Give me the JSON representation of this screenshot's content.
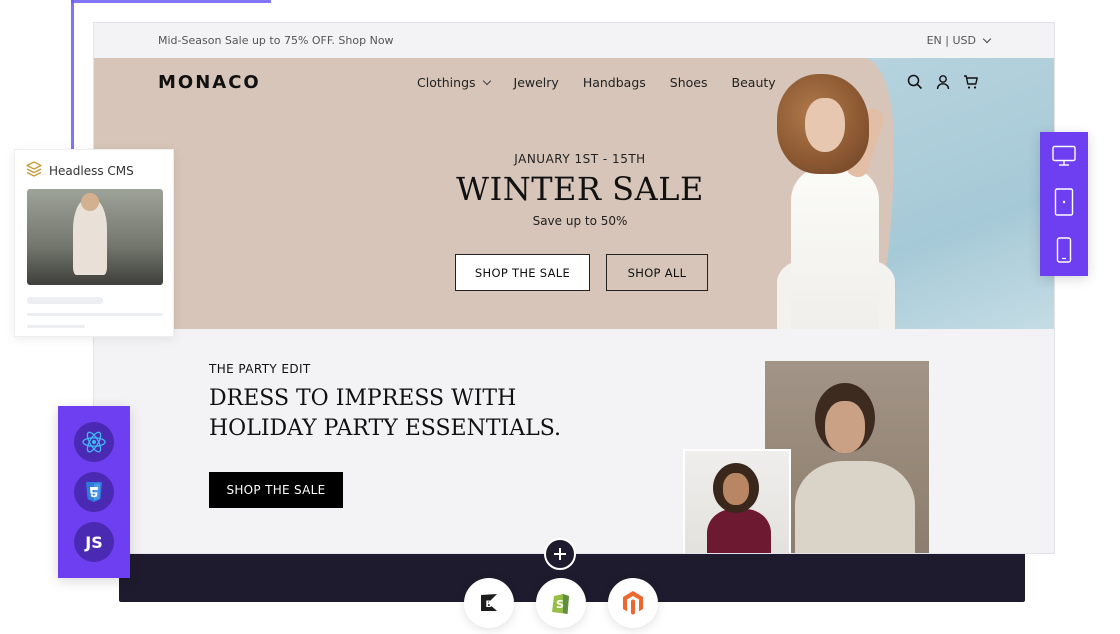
{
  "promo": {
    "text": "Mid-Season Sale up to 75% OFF. Shop Now",
    "locale": "EN | USD"
  },
  "brand": {
    "logo": "MONACO"
  },
  "nav": {
    "items": [
      "Clothings",
      "Jewelry",
      "Handbags",
      "Shoes",
      "Beauty"
    ]
  },
  "hero": {
    "date": "JANUARY 1ST - 15TH",
    "title": "WINTER SALE",
    "subtitle": "Save up to 50%",
    "primary_btn": "SHOP THE SALE",
    "secondary_btn": "SHOP ALL"
  },
  "edit": {
    "kicker": "THE PARTY EDIT",
    "title": "DRESS TO IMPRESS WITH HOLIDAY PARTY ESSENTIALS.",
    "btn": "SHOP THE SALE"
  },
  "cms": {
    "title": "Headless CMS"
  },
  "tech": {
    "js_label": "JS"
  },
  "icons": {
    "nav": [
      "search-icon",
      "user-icon",
      "cart-icon"
    ],
    "tech": [
      "react-icon",
      "css3-icon",
      "javascript-icon"
    ],
    "devices": [
      "desktop-icon",
      "tablet-icon",
      "mobile-icon"
    ],
    "platforms": [
      "bigcommerce-icon",
      "shopify-icon",
      "magento-icon"
    ],
    "cms": "layers-icon"
  },
  "colors": {
    "accent": "#6d3ff0",
    "hero_bg": "#d6c5b8",
    "dark": "#1e1b2e"
  }
}
